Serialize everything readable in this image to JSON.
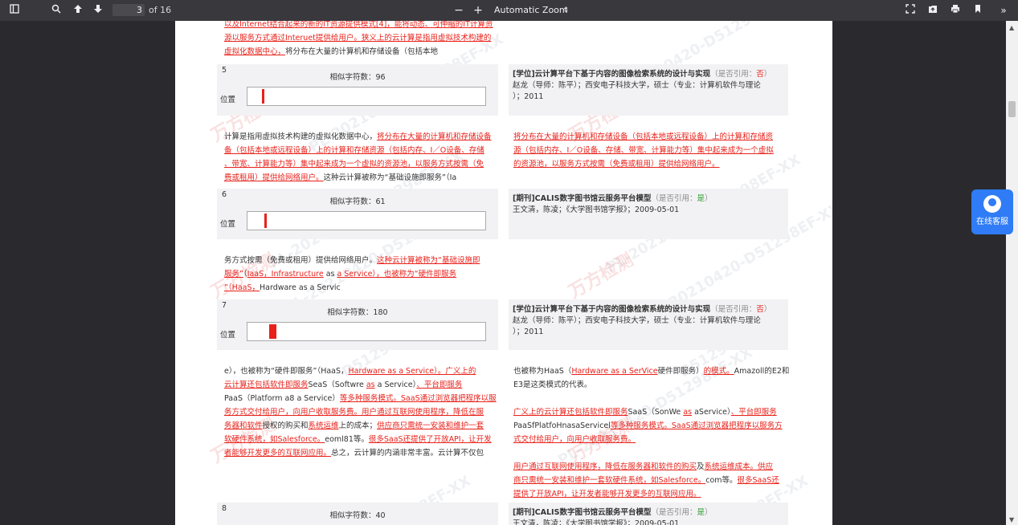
{
  "toolbar": {
    "sidebar_icon": "sidebar-toggle-icon",
    "search_icon": "search-icon",
    "page_number": "3",
    "page_of": "of 16",
    "zoom_minus": "−",
    "zoom_plus": "+",
    "zoom_value": "Automatic Zoom",
    "zoom_caret": "⇕"
  },
  "watermarks": {
    "code": "PL-20210420-D51298EF-XX",
    "code_short": "D51298EF-XX",
    "brand": "万方检测"
  },
  "intro": {
    "line1": "以及Internet结合起来的新的IT资源提供模式[4]，能将动态、可伸缩的IT计算资",
    "line2": "源以服务方式通过Interuet提供给用户。狭义上的云计算是指用虚拟技术构建的",
    "line3_red": "虚拟化数据中心，",
    "line3_grey": "将分布在大量的计算机和存储设备（包括本地"
  },
  "sections": [
    {
      "num": "5",
      "sim_label": "相似字符数：96",
      "pos_label": "位置",
      "source_title": "[学位]云计算平台下基于内容的图像检索系统的设计与实现",
      "cite_label": "（是否引用：",
      "cite_value": "否",
      "cite_end": "）",
      "source_line2": "赵龙（导师：陈平）；西安电子科技大学，硕士（专业：计算机软件与理论",
      "source_line3": "）；2011"
    },
    {
      "num": "6",
      "sim_label": "相似字符数：61",
      "pos_label": "位置",
      "source_title": "[期刊]CALIS数字图书馆云服务平台模型",
      "cite_label": "（是否引用：",
      "cite_value": "是",
      "cite_end": "）",
      "source_line2": "王文清，陈凌；《大学图书馆学报》；2009-05-01"
    },
    {
      "num": "7",
      "sim_label": "相似字符数：180",
      "pos_label": "位置",
      "source_title": "[学位]云计算平台下基于内容的图像检索系统的设计与实现",
      "cite_label": "（是否引用：",
      "cite_value": "否",
      "cite_end": "）",
      "source_line2": "赵龙（导师：陈平）；西安电子科技大学，硕士（专业：计算机软件与理论",
      "source_line3": "）；2011"
    },
    {
      "num": "8",
      "sim_label": "相似字符数：40",
      "source_title": "[期刊]CALIS数字图书馆云服务平台模型",
      "cite_label": "（是否引用：",
      "cite_value": "是",
      "cite_end": "）",
      "source_line2": "王文清，陈凌；《大学图书馆学报》；2009-05-01"
    }
  ],
  "text5": {
    "left_l1_grey": "计算是指用虚拟技术构建的虚拟化数据中心，",
    "left_l1_red": "将分布在大量的计算机和存储设备",
    "left_l2": "备（包括本地或远程设备）上的计算和存储资源（包括内存、I／O设备、存储",
    "left_l3": "、带宽、计算能力等）集中起来成为一个虚拟的资源池，以服务方式按需（免",
    "left_l4_red": "费或租用）提供给网络用户。",
    "left_l4_grey": "这种云计算被称为“基础设施即服务”（Ia",
    "right_l1": "将分布在大量的计算机和存储设备（包括本地或远程设备）上的计算和存储资",
    "right_l2": "源（包括内存、I／O设备、存储、带宽、计算能力等）集中起来成为一个虚拟",
    "right_l3": "的资源池，以服务方式按需（免费或租用）提供给网络用户。"
  },
  "text6": {
    "left_l1_grey": "务方式按需（免费或租用）提供给网络用户。",
    "left_l1_red": "这种云计算被称为“基础设施即",
    "left_l2_red1": "服务”",
    "left_l2_grey1": "（",
    "left_l2_red2": "IaaS，Infrastructure",
    "left_l2_grey2": " as ",
    "left_l2_red3": "a Service），也被称为“硬件即服务",
    "left_l3_red": "”（HaaS，",
    "left_l3_grey": "Hardware as a Servic"
  },
  "text7": {
    "left_l1_grey": "e），也被称为“硬件即服务”（HaaS，",
    "left_l1_red": "Hardware as a Service）。广义上的",
    "left_l2_red": "云计算还包括软件即服务",
    "left_l2_grey": "SeaS（Softwre ",
    "left_l2_red2": "as",
    "left_l2_grey2": " a Service）",
    "left_l2_red3": "、平台即服务",
    "left_l3_grey": "PaaS（Platform a8 a Service）",
    "left_l3_red": "等多种服务模式。SaaS通过浏览器把程序以服",
    "left_l4": "务方式交付给用户，向用户收取服务费。用户通过互联网使用程序，降低在服",
    "left_l5_red": "务器和软件",
    "left_l5_grey": "授权的购买和",
    "left_l5_red2": "系统运维",
    "left_l5_grey2": "上的成本；",
    "left_l5_red3": "供应商只需统一安装和维护一套",
    "left_l6_red": "软硬件系统，如Salesforce。",
    "left_l6_grey": "eoml81等。",
    "left_l6_red2": "很多SaaS还提供了开放API，让开发",
    "left_l7_red": "者能够开发更多的互联网应用。",
    "left_l7_grey": "总之，云计算的内涵非常丰富。云计算不仅包",
    "right_l1_grey": "也被称为HaaS（",
    "right_l1_red": "Hardware as a SerVice",
    "right_l1_grey2": "硬件即服务）",
    "right_l1_red2": "的模式。",
    "right_l1_grey3": "Amazoll的E2和",
    "right_l2": "E3是这类模式的代表。",
    "right_l3_red": "广义上的云计算还包括软件即服务",
    "right_l3_grey": "SaaS（SonWe ",
    "right_l3_red2": "as",
    "right_l3_grey2": " aService）",
    "right_l3_red3": "、平台即服务",
    "right_l4_grey": "PaaSfPlatfoHnasaServicel",
    "right_l4_red": "等多种服务模式。SaaS通过浏览器把程序以服务方",
    "right_l5_red": "式交付给用户，向用户收取服务费。",
    "right_l6_red": "用户通过互联网使用程序，降低在服务器和软件的购买",
    "right_l6_grey": "及",
    "right_l6_red2": "系统运维成本。供应",
    "right_l7_red": "商只需统一安装和维护一套软硬件系统，如Salesforce。",
    "right_l7_grey": "com等。",
    "right_l7_red2": "很多SaaS还",
    "right_l8_red": "提供了开放API，让开发者能够开发更多的互联网应用。"
  },
  "similarity_marks": [
    0.06,
    0.07,
    0.09
  ],
  "service_button": "在线客服"
}
